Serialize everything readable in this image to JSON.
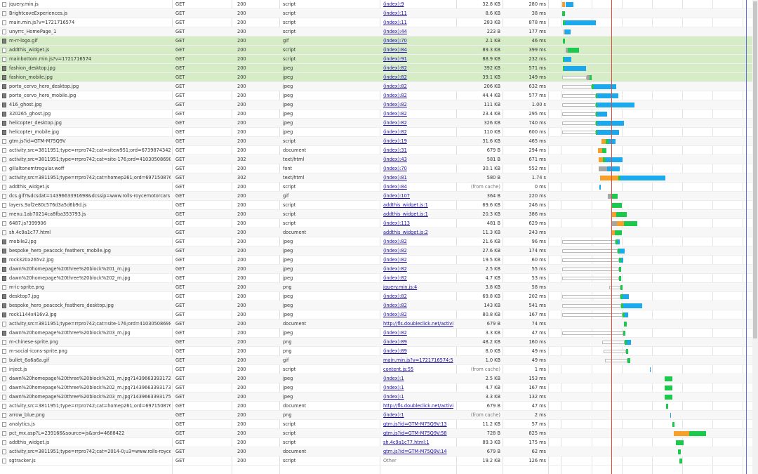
{
  "colors": {
    "highlight_row": "#d6ecc7",
    "waiting": "#1bc94c",
    "download": "#19a9ec",
    "ssl": "#f6a02a",
    "dom_content_loaded_line": "#e8483a",
    "load_line": "#5b6fe6"
  },
  "requests": [
    {
      "name": "jquery.min.js",
      "method": "GET",
      "status": "200",
      "type": "script",
      "initiator": "(index):9",
      "size": "32.8 KB",
      "time": "280 ms",
      "icon": "file-icon"
    },
    {
      "name": "BrightcoveExperiences.js",
      "method": "GET",
      "status": "200",
      "type": "script",
      "initiator": "(index):11",
      "size": "8.6 KB",
      "time": "38 ms",
      "icon": "file-icon"
    },
    {
      "name": "main.min.js?v=1721716574",
      "method": "GET",
      "status": "200",
      "type": "script",
      "initiator": "(index):11",
      "size": "283 KB",
      "time": "878 ms",
      "icon": "file-icon"
    },
    {
      "name": "unyrrc_HomePage_1",
      "method": "GET",
      "status": "200",
      "type": "script",
      "initiator": "(index):44",
      "size": "223 B",
      "time": "177 ms",
      "icon": "file-icon"
    },
    {
      "name": "m-rr-logo.gif",
      "method": "GET",
      "status": "200",
      "type": "gif",
      "initiator": "(index):70",
      "size": "2.1 KB",
      "time": "46 ms",
      "icon": "image-icon"
    },
    {
      "name": "addthis_widget.js",
      "method": "GET",
      "status": "200",
      "type": "script",
      "initiator": "(index):84",
      "size": "89.3 KB",
      "time": "399 ms",
      "icon": "file-icon"
    },
    {
      "name": "mainbottom.min.js?v=1721716574",
      "method": "GET",
      "status": "200",
      "type": "script",
      "initiator": "(index):91",
      "size": "88.9 KB",
      "time": "232 ms",
      "icon": "file-icon"
    },
    {
      "name": "fashion_desktop.jpg",
      "method": "GET",
      "status": "200",
      "type": "jpeg",
      "initiator": "(index):82",
      "size": "392 KB",
      "time": "571 ms",
      "icon": "image-icon"
    },
    {
      "name": "fashion_mobile.jpg",
      "method": "GET",
      "status": "200",
      "type": "jpeg",
      "initiator": "(index):82",
      "size": "39.1 KB",
      "time": "149 ms",
      "icon": "image-icon"
    },
    {
      "name": "porto_cervo_hero_desktop.jpg",
      "method": "GET",
      "status": "200",
      "type": "jpeg",
      "initiator": "(index):82",
      "size": "206 KB",
      "time": "632 ms",
      "icon": "image-icon"
    },
    {
      "name": "porto_cervo_hero_mobile.jpg",
      "method": "GET",
      "status": "200",
      "type": "jpeg",
      "initiator": "(index):82",
      "size": "44.4 KB",
      "time": "577 ms",
      "icon": "image-icon"
    },
    {
      "name": "416_ghost.jpg",
      "method": "GET",
      "status": "200",
      "type": "jpeg",
      "initiator": "(index):82",
      "size": "111 KB",
      "time": "1.00 s",
      "icon": "image-icon"
    },
    {
      "name": "320265_ghost.jpg",
      "method": "GET",
      "status": "200",
      "type": "jpeg",
      "initiator": "(index):82",
      "size": "23.4 KB",
      "time": "295 ms",
      "icon": "image-icon"
    },
    {
      "name": "helicopter_desktop.jpg",
      "method": "GET",
      "status": "200",
      "type": "jpeg",
      "initiator": "(index):82",
      "size": "326 KB",
      "time": "740 ms",
      "icon": "image-icon"
    },
    {
      "name": "helicopter_mobile.jpg",
      "method": "GET",
      "status": "200",
      "type": "jpeg",
      "initiator": "(index):82",
      "size": "110 KB",
      "time": "600 ms",
      "icon": "image-icon"
    },
    {
      "name": "gtm.js?id=GTM-M75Q9V",
      "method": "GET",
      "status": "200",
      "type": "script",
      "initiator": "(index):19",
      "size": "31.6 KB",
      "time": "465 ms",
      "icon": "file-icon"
    },
    {
      "name": "activity;src=3811951;type=rrpro742;cat=sitew951;ord=6739874342456.46",
      "method": "GET",
      "status": "200",
      "type": "document",
      "initiator": "(index):31",
      "size": "679 B",
      "time": "294 ms",
      "icon": "file-icon"
    },
    {
      "name": "activity;src=3811951;type=rrpro742;cat=site-176;ord=4103050869889.55575",
      "method": "GET",
      "status": "302",
      "type": "text/html",
      "initiator": "(index):43",
      "size": "581 B",
      "time": "671 ms",
      "icon": "file-icon"
    },
    {
      "name": "gillaltonemtregular.woff",
      "method": "GET",
      "status": "200",
      "type": "font",
      "initiator": "(index):70",
      "size": "30.1 KB",
      "time": "552 ms",
      "icon": "file-icon"
    },
    {
      "name": "activity;src=3811951;type=rrpro742;cat=homep261;ord=69715087697841",
      "method": "GET",
      "status": "302",
      "type": "text/html",
      "initiator": "(index):81",
      "size": "580 B",
      "time": "1.74 s",
      "icon": "file-icon"
    },
    {
      "name": "addthis_widget.js",
      "method": "GET",
      "status": "200",
      "type": "script",
      "initiator": "(index):84",
      "size": "(from cache)",
      "time": "0 ms",
      "icon": "file-icon"
    },
    {
      "name": "dcs.gif?&dcsdat=1439663391698&dcssip=www.rolls-roycemotorcars.com",
      "method": "GET",
      "status": "200",
      "type": "gif",
      "initiator": "(index):107",
      "size": "364 B",
      "time": "220 ms",
      "icon": "file-icon"
    },
    {
      "name": "layers.9af2e80c576d3a5d6b9d.js",
      "method": "GET",
      "status": "200",
      "type": "script",
      "initiator": "addthis_widget.js:1",
      "size": "69.6 KB",
      "time": "246 ms",
      "icon": "file-icon"
    },
    {
      "name": "menu.1ab70214ca8fba353793.js",
      "method": "GET",
      "status": "200",
      "type": "script",
      "initiator": "addthis_widget.js:1",
      "size": "20.3 KB",
      "time": "386 ms",
      "icon": "file-icon"
    },
    {
      "name": "6487.js?399906",
      "method": "GET",
      "status": "200",
      "type": "script",
      "initiator": "(index):113",
      "size": "481 B",
      "time": "629 ms",
      "icon": "file-icon"
    },
    {
      "name": "sh.4c9a1c77.html",
      "method": "GET",
      "status": "200",
      "type": "document",
      "initiator": "addthis_widget.js:2",
      "size": "11.3 KB",
      "time": "243 ms",
      "icon": "file-icon"
    },
    {
      "name": "mobile2.jpg",
      "method": "GET",
      "status": "200",
      "type": "jpeg",
      "initiator": "(index):82",
      "size": "21.6 KB",
      "time": "96 ms",
      "icon": "image-icon"
    },
    {
      "name": "bespoke_hero_peacock_feathers_mobile.jpg",
      "method": "GET",
      "status": "200",
      "type": "jpeg",
      "initiator": "(index):82",
      "size": "27.6 KB",
      "time": "174 ms",
      "icon": "image-icon"
    },
    {
      "name": "rock320x265v2.jpg",
      "method": "GET",
      "status": "200",
      "type": "jpeg",
      "initiator": "(index):82",
      "size": "19.5 KB",
      "time": "60 ms",
      "icon": "image-icon"
    },
    {
      "name": "dawn%20homepage%20three%20block%201_m.jpg",
      "method": "GET",
      "status": "200",
      "type": "jpeg",
      "initiator": "(index):82",
      "size": "2.5 KB",
      "time": "55 ms",
      "icon": "image-icon"
    },
    {
      "name": "dawn%20homepage%20three%20block%202_m.jpg",
      "method": "GET",
      "status": "200",
      "type": "jpeg",
      "initiator": "(index):82",
      "size": "4.7 KB",
      "time": "53 ms",
      "icon": "image-icon"
    },
    {
      "name": "m-ic-sprite.png",
      "method": "GET",
      "status": "200",
      "type": "png",
      "initiator": "jquery.min.js:4",
      "size": "3.8 KB",
      "time": "58 ms",
      "icon": "file-icon"
    },
    {
      "name": "desktop7.jpg",
      "method": "GET",
      "status": "200",
      "type": "jpeg",
      "initiator": "(index):82",
      "size": "69.8 KB",
      "time": "202 ms",
      "icon": "image-icon"
    },
    {
      "name": "bespoke_hero_peacock_feathers_desktop.jpg",
      "method": "GET",
      "status": "200",
      "type": "jpeg",
      "initiator": "(index):82",
      "size": "143 KB",
      "time": "541 ms",
      "icon": "image-icon"
    },
    {
      "name": "rock1144x416v3.jpg",
      "method": "GET",
      "status": "200",
      "type": "jpeg",
      "initiator": "(index):82",
      "size": "80.8 KB",
      "time": "167 ms",
      "icon": "image-icon"
    },
    {
      "name": "activity;src=3811951;type=rrpro742;cat=site-176;ord=4103050869889.55575",
      "method": "GET",
      "status": "200",
      "type": "document",
      "initiator": "http://fls.doubleclick.net/activit...",
      "size": "679 B",
      "time": "74 ms",
      "icon": "file-icon"
    },
    {
      "name": "dawn%20homepage%20three%20block%203_m.jpg",
      "method": "GET",
      "status": "200",
      "type": "jpeg",
      "initiator": "(index):82",
      "size": "3.3 KB",
      "time": "47 ms",
      "icon": "image-icon"
    },
    {
      "name": "m-chinese-sprite.png",
      "method": "GET",
      "status": "200",
      "type": "png",
      "initiator": "(index):89",
      "size": "48.2 KB",
      "time": "160 ms",
      "icon": "file-icon"
    },
    {
      "name": "m-social-icons-sprite.png",
      "method": "GET",
      "status": "200",
      "type": "png",
      "initiator": "(index):89",
      "size": "8.0 KB",
      "time": "49 ms",
      "icon": "file-icon"
    },
    {
      "name": "bullet_6a6a6a.gif",
      "method": "GET",
      "status": "200",
      "type": "gif",
      "initiator": "main.min.js?v=1721716574:5",
      "size": "1.0 KB",
      "time": "49 ms",
      "icon": "file-icon"
    },
    {
      "name": "inject.js",
      "method": "GET",
      "status": "200",
      "type": "script",
      "initiator": "content.js:55",
      "size": "(from cache)",
      "time": "1 ms",
      "icon": "file-icon"
    },
    {
      "name": "dawn%20homepage%20three%20block%201_m.jpg?1439663393172",
      "method": "GET",
      "status": "200",
      "type": "jpeg",
      "initiator": "(index):1",
      "size": "2.5 KB",
      "time": "153 ms",
      "icon": "file-icon"
    },
    {
      "name": "dawn%20homepage%20three%20block%202_m.jpg?1439663393173",
      "method": "GET",
      "status": "200",
      "type": "jpeg",
      "initiator": "(index):1",
      "size": "4.7 KB",
      "time": "167 ms",
      "icon": "file-icon"
    },
    {
      "name": "dawn%20homepage%20three%20block%203_m.jpg?1439663393175",
      "method": "GET",
      "status": "200",
      "type": "jpeg",
      "initiator": "(index):1",
      "size": "3.3 KB",
      "time": "132 ms",
      "icon": "file-icon"
    },
    {
      "name": "activity;src=3811951;type=rrpro742;cat=homep261;ord=69715087697841",
      "method": "GET",
      "status": "200",
      "type": "document",
      "initiator": "http://fls.doubleclick.net/activit...",
      "size": "679 B",
      "time": "47 ms",
      "icon": "file-icon"
    },
    {
      "name": "arrow_blue.png",
      "method": "GET",
      "status": "200",
      "type": "png",
      "initiator": "(index):1",
      "size": "(from cache)",
      "time": "2 ms",
      "icon": "file-icon"
    },
    {
      "name": "analytics.js",
      "method": "GET",
      "status": "200",
      "type": "script",
      "initiator": "gtm.js?id=GTM-M75Q9V:13",
      "size": "11.2 KB",
      "time": "57 ms",
      "icon": "file-icon"
    },
    {
      "name": "pct_mx.asp?L=239166&source=js&ord=4688422",
      "method": "GET",
      "status": "200",
      "type": "script",
      "initiator": "gtm.js?id=GTM-M75Q9V:58",
      "size": "728 B",
      "time": "825 ms",
      "icon": "file-icon"
    },
    {
      "name": "addthis_widget.js",
      "method": "GET",
      "status": "200",
      "type": "script",
      "initiator": "sh.4c9a1c77.html:1",
      "size": "89.3 KB",
      "time": "175 ms",
      "icon": "file-icon"
    },
    {
      "name": "activity;src=3811951;type=rrpro742;cat=2014-0;u3=www.rolls-roycemotorcars",
      "method": "GET",
      "status": "200",
      "type": "document",
      "initiator": "gtm.js?id=GTM-M75Q9V:14",
      "size": "679 B",
      "time": "62 ms",
      "icon": "file-icon"
    },
    {
      "name": "sgtracker.js",
      "method": "GET",
      "status": "200",
      "type": "script",
      "initiator": "Other",
      "size": "19.2 KB",
      "time": "126 ms",
      "icon": "file-icon"
    }
  ]
}
